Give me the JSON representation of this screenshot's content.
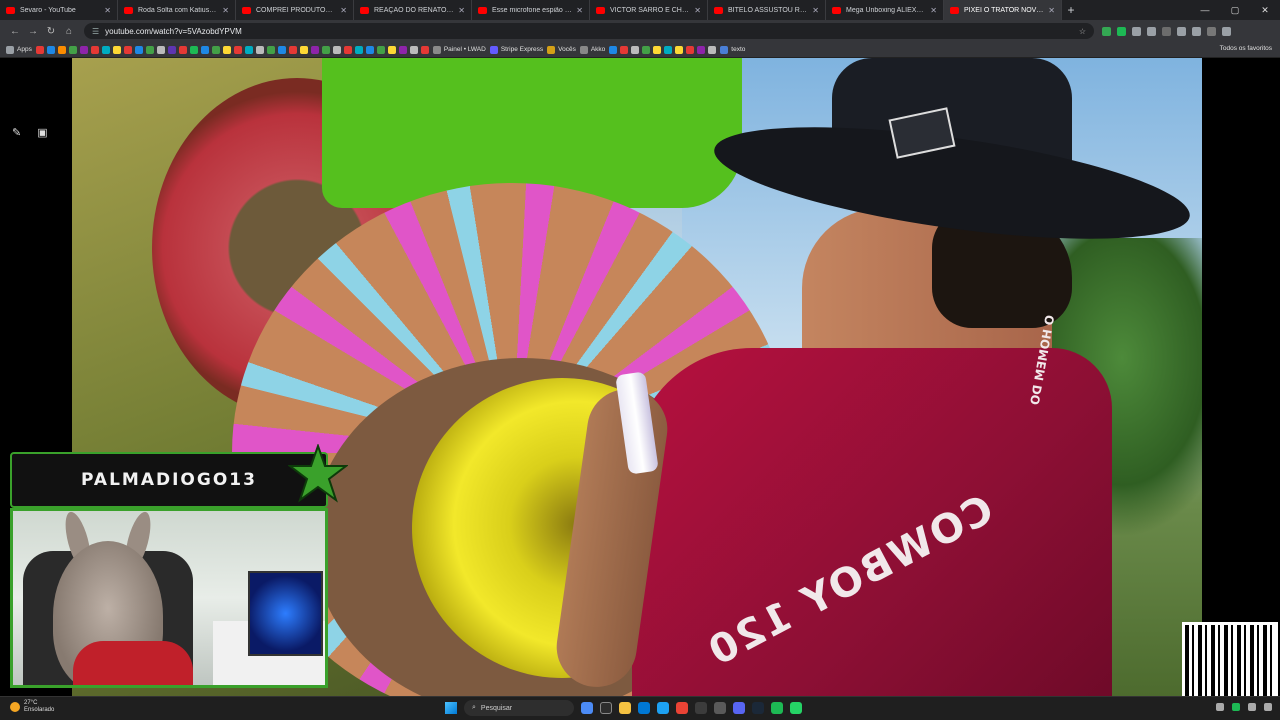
{
  "browser": {
    "tabs": [
      {
        "label": "Sevaro - YouTube",
        "active": false
      },
      {
        "label": "Roda Solta com Katiusha a Ru",
        "active": false
      },
      {
        "label": "COMPREI PRODUTOS que ning",
        "active": false
      },
      {
        "label": "REAÇÃO DO RENATO GARCIA",
        "active": false
      },
      {
        "label": "Esse microfone espião permite",
        "active": false
      },
      {
        "label": "VICTOR SARRO E CHARLES HE",
        "active": false
      },
      {
        "label": "BITELO ASSUSTOU RICHARD R",
        "active": false
      },
      {
        "label": "Mega Unboxing ALIEXPRESS d",
        "active": false
      },
      {
        "label": "PIXEI O TRATOR NOVO DO",
        "active": true
      }
    ],
    "new_tab_label": "+",
    "url": "youtube.com/watch?v=5VAzobdYPVM",
    "bookmarks": {
      "apps_label": "Apps",
      "items": [
        {
          "label": "Painel • LWAD",
          "color": "#8a8a8a"
        },
        {
          "label": "Stripe Express",
          "color": "#635bff"
        },
        {
          "label": "Vocês",
          "color": "#d4a017"
        },
        {
          "label": "Akko",
          "color": "#888888"
        },
        {
          "label": "texto",
          "color": "#4a7fd6"
        }
      ],
      "all_favorites_label": "Todos os favoritos"
    }
  },
  "stream_overlay": {
    "streamer_name": "PALMADIOGO13",
    "accent_color": "#3aa12b"
  },
  "video": {
    "shirt_text": "COWBOY 120",
    "collar_text": "O HOMEM DO"
  },
  "taskbar": {
    "weather_temp": "27°C",
    "weather_desc": "Ensolarado",
    "search_placeholder": "Pesquisar"
  }
}
